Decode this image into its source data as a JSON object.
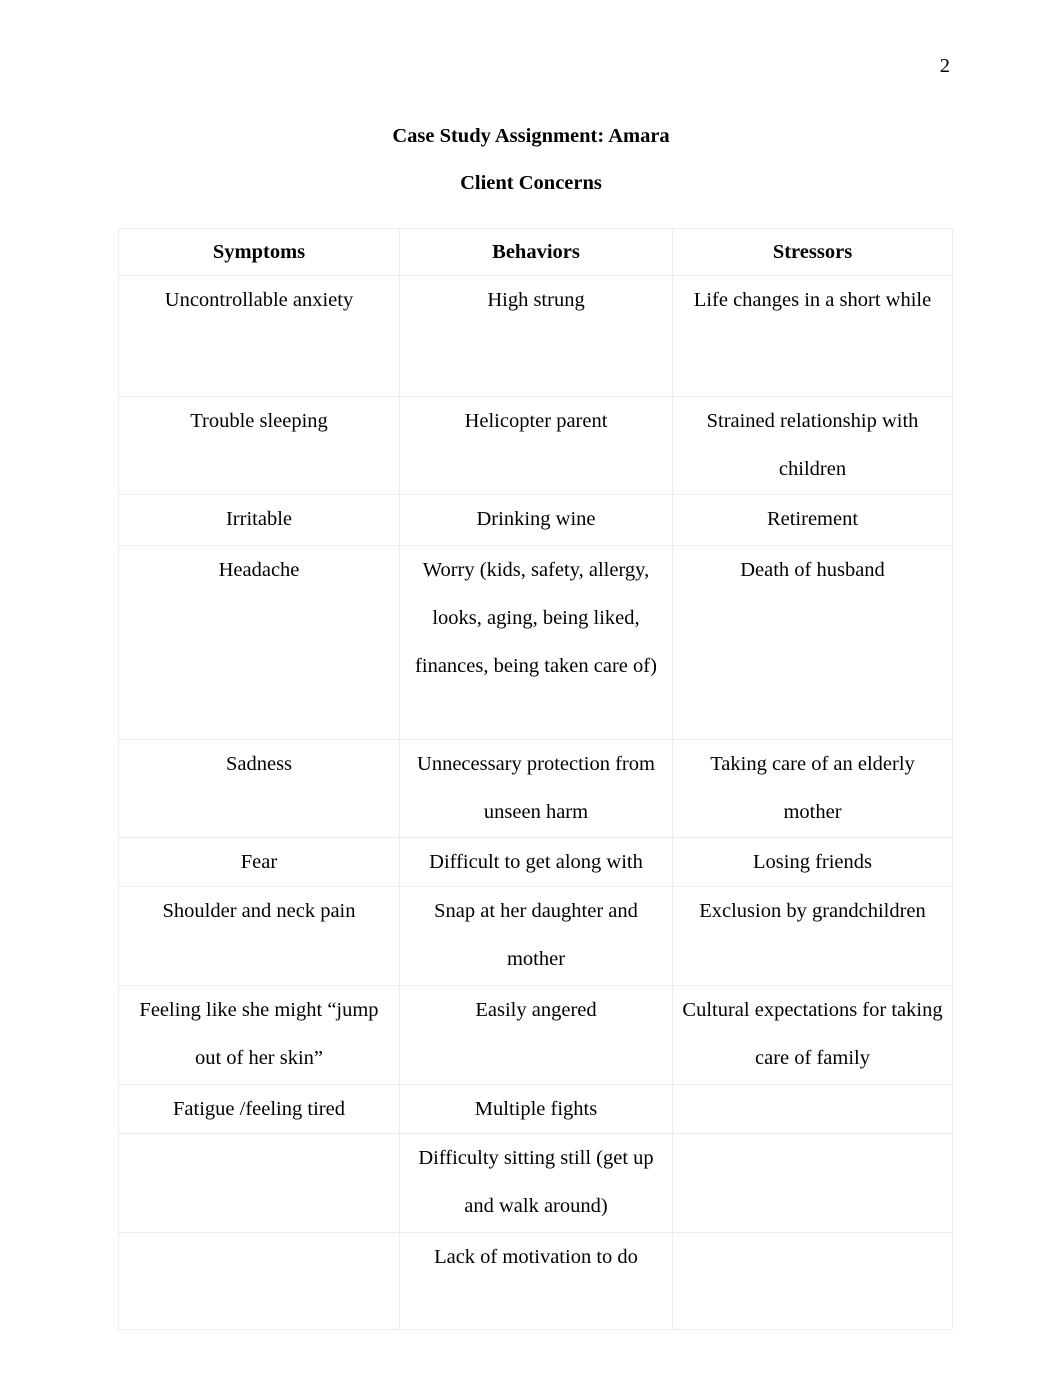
{
  "page": {
    "number": "2",
    "title": "Case Study Assignment: Amara",
    "subtitle": "Client Concerns"
  },
  "table": {
    "headers": [
      "Symptoms",
      "Behaviors",
      "Stressors"
    ],
    "rows": [
      {
        "symptoms": "Uncontrollable anxiety",
        "behaviors": "High strung",
        "stressors": "Life changes in a short while"
      },
      {
        "symptoms": "Trouble sleeping",
        "behaviors": "Helicopter parent",
        "stressors": "Strained relationship with children"
      },
      {
        "symptoms": "Irritable",
        "behaviors": "Drinking wine",
        "stressors": "Retirement"
      },
      {
        "symptoms": "Headache",
        "behaviors": "Worry (kids, safety, allergy, looks, aging, being liked, finances, being taken care of)",
        "stressors": "Death of husband"
      },
      {
        "symptoms": "Sadness",
        "behaviors": "Unnecessary protection from unseen harm",
        "stressors": "Taking care of an elderly mother"
      },
      {
        "symptoms": "Fear",
        "behaviors": "Difficult to get along with",
        "stressors": "Losing friends"
      },
      {
        "symptoms": "Shoulder and neck pain",
        "behaviors": "Snap at her daughter and mother",
        "stressors": "Exclusion by grandchildren"
      },
      {
        "symptoms": "Feeling like she might “jump out of her skin”",
        "behaviors": "Easily angered",
        "stressors": "Cultural expectations for taking care of family"
      },
      {
        "symptoms": "Fatigue /feeling tired",
        "behaviors": "Multiple fights",
        "stressors": ""
      },
      {
        "symptoms": "",
        "behaviors": "Difficulty sitting still (get up and walk around)",
        "stressors": ""
      },
      {
        "symptoms": "",
        "behaviors": "Lack of motivation to do",
        "stressors": ""
      }
    ]
  },
  "colors": {
    "text": "#000000",
    "page_background": "#ffffff",
    "table_border": "#eceded"
  }
}
